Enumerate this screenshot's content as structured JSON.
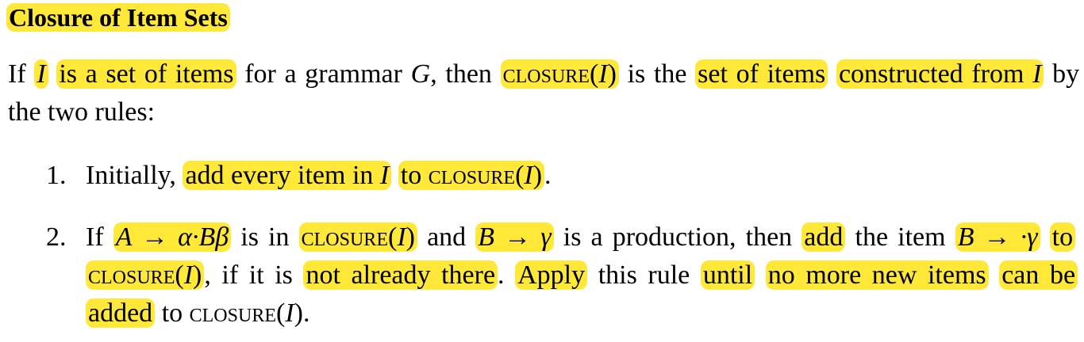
{
  "title": "Closure of Item Sets",
  "definition": {
    "if": "If",
    "I": "I",
    "is_a_set_of_items": "is a set of items",
    "for_a_grammar": "for a grammar",
    "G": "G",
    "then": ", then",
    "closure": "closure",
    "closure_arg": "I",
    "is_the": "is the",
    "set_of_items": "set of items",
    "constructed_from": "constructed from",
    "by_two_rules": "by the two rules:"
  },
  "rules": [
    {
      "number": "1.",
      "initially": "Initially,",
      "add_every_item_in": "add every item in",
      "I": "I",
      "to": "to",
      "closure": "closure",
      "end": "."
    },
    {
      "number": "2.",
      "if": "If",
      "prod1": "A → α·Bβ",
      "is_in": "is in",
      "closure": "closure",
      "and": "and",
      "prod2": "B → γ",
      "is_a_production": "is a production, then",
      "add": "add",
      "the_item": "the item",
      "prod3": "B → ·γ",
      "to": "to",
      "if_not": ", if it is",
      "not_already_there": "not already there",
      "period": ".",
      "apply": "Apply",
      "this_rule": "this rule",
      "until": "until",
      "no_more_new_items": "no more new items",
      "can_be_added": "can be added",
      "to_closure": "to",
      "end": "."
    }
  ]
}
